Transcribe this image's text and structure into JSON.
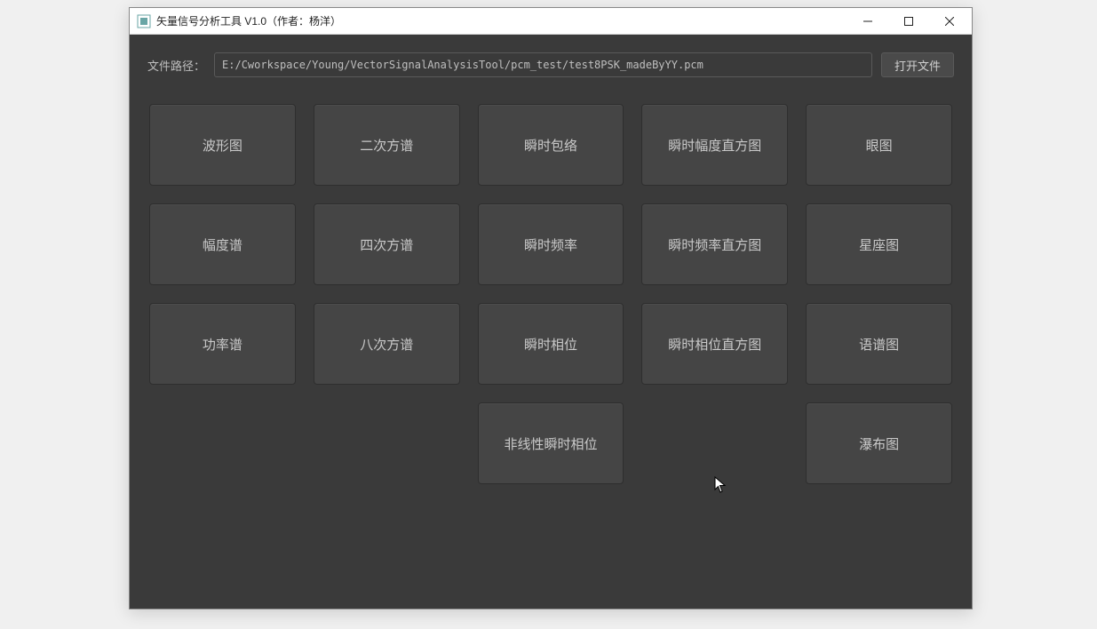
{
  "window": {
    "title": "矢量信号分析工具 V1.0（作者：杨洋）"
  },
  "path": {
    "label": "文件路径：",
    "value": "E:/Cworkspace/Young/VectorSignalAnalysisTool/pcm_test/test8PSK_madeByYY.pcm",
    "open_button": "打开文件"
  },
  "tiles": {
    "row1": {
      "c1": "波形图",
      "c2": "二次方谱",
      "c3": "瞬时包络",
      "c4": "瞬时幅度直方图",
      "c5": "眼图"
    },
    "row2": {
      "c1": "幅度谱",
      "c2": "四次方谱",
      "c3": "瞬时频率",
      "c4": "瞬时频率直方图",
      "c5": "星座图"
    },
    "row3": {
      "c1": "功率谱",
      "c2": "八次方谱",
      "c3": "瞬时相位",
      "c4": "瞬时相位直方图",
      "c5": "语谱图"
    },
    "row4": {
      "c3": "非线性瞬时相位",
      "c5": "瀑布图"
    }
  }
}
